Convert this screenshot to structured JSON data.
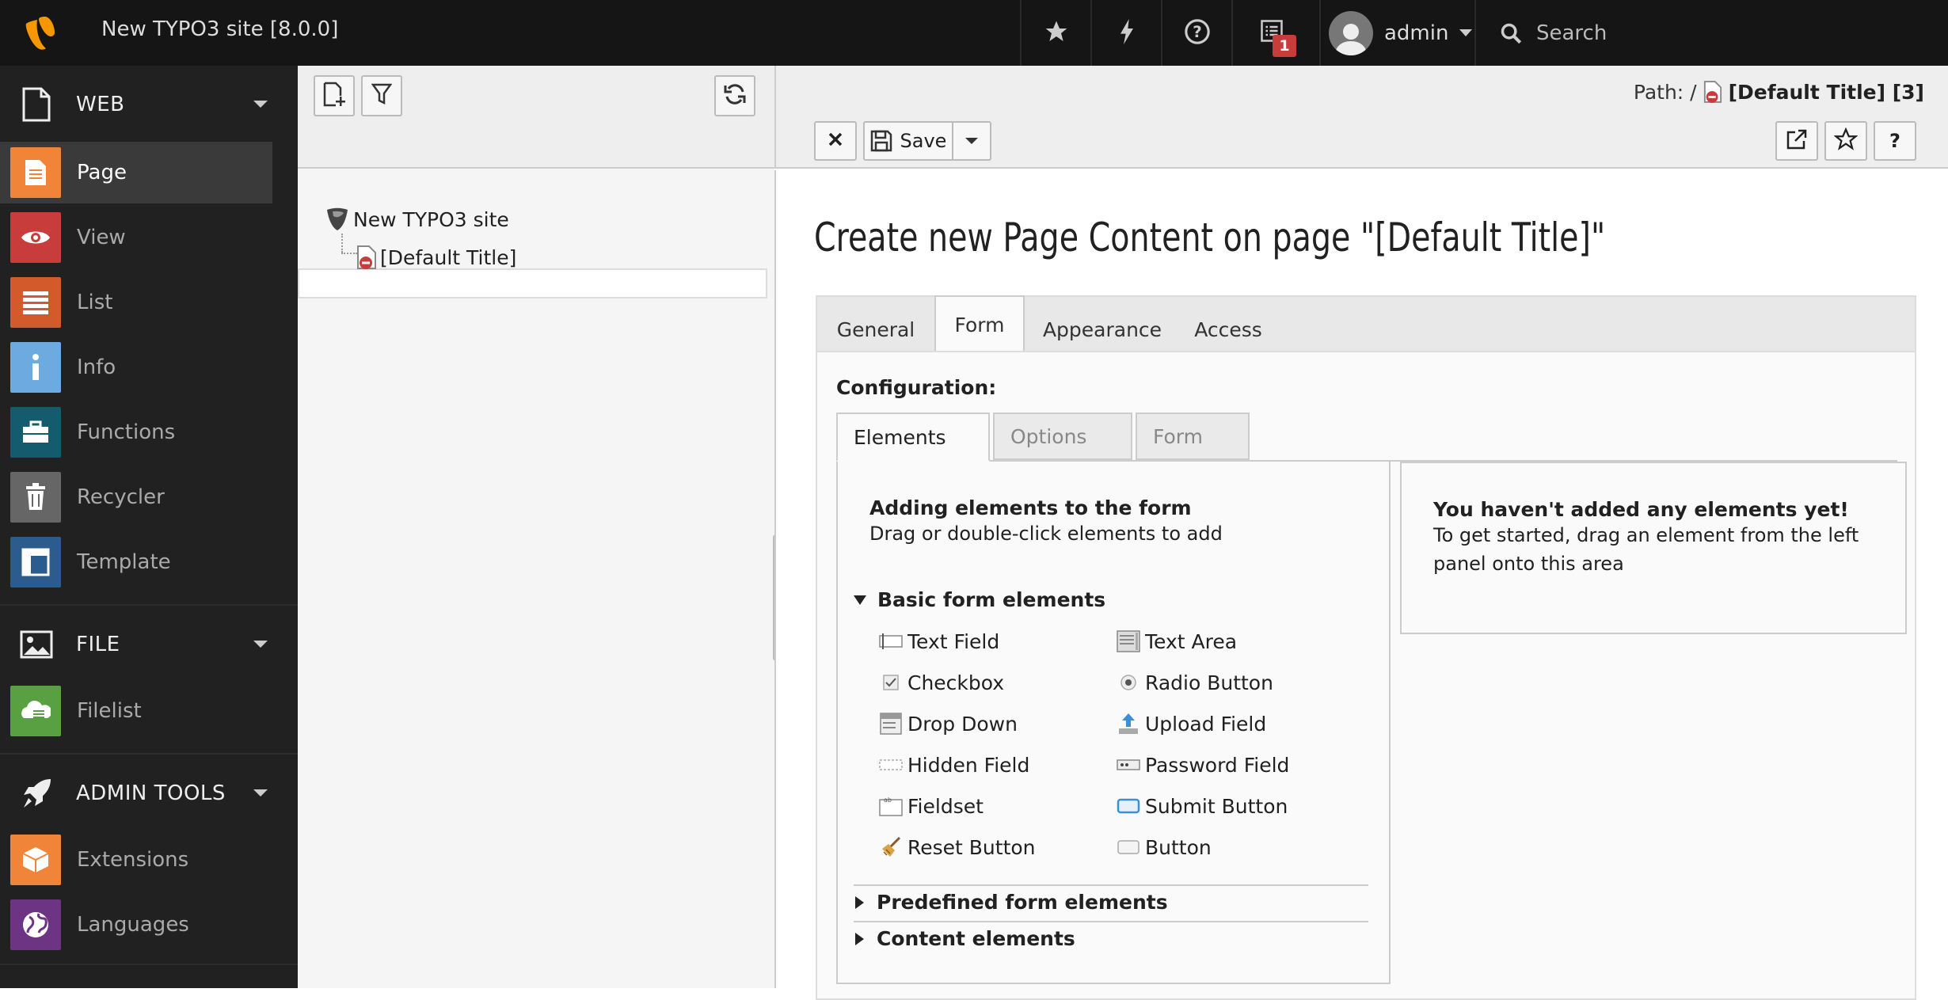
{
  "topbar": {
    "site_title": "New TYPO3 site [8.0.0]",
    "notification_count": "1",
    "username": "admin",
    "search_placeholder": "Search"
  },
  "modules": {
    "web": {
      "label": "WEB",
      "items": [
        {
          "label": "Page",
          "color": "#f0853a"
        },
        {
          "label": "View",
          "color": "#c83c3c"
        },
        {
          "label": "List",
          "color": "#d35a2a"
        },
        {
          "label": "Info",
          "color": "#6daae0"
        },
        {
          "label": "Functions",
          "color": "#145c6d"
        },
        {
          "label": "Recycler",
          "color": "#666666"
        },
        {
          "label": "Template",
          "color": "#2c5b8e"
        }
      ]
    },
    "file": {
      "label": "FILE",
      "items": [
        {
          "label": "Filelist",
          "color": "#58a042"
        }
      ]
    },
    "admin": {
      "label": "ADMIN TOOLS",
      "items": [
        {
          "label": "Extensions",
          "color": "#f0853a"
        },
        {
          "label": "Languages",
          "color": "#6c3483"
        }
      ]
    }
  },
  "tree": {
    "root": "New TYPO3 site",
    "child": "[Default Title]"
  },
  "docheader": {
    "path_label": "Path: /",
    "path_value": "[Default Title] [3]",
    "save_label": "Save"
  },
  "content": {
    "heading": "Create new Page Content on page \"[Default Title]\"",
    "tabs": [
      "General",
      "Form",
      "Appearance",
      "Access"
    ],
    "configuration_label": "Configuration:",
    "inner_tabs": [
      "Elements",
      "Options",
      "Form"
    ],
    "adding_title": "Adding elements to the form",
    "adding_text": "Drag or double-click elements to add",
    "empty_title": "You haven't added any elements yet!",
    "empty_text_1": "To get started, drag an element from the left",
    "empty_text_2": "panel onto this area",
    "basic_section": "Basic form elements",
    "elements": [
      "Text Field",
      "Text Area",
      "Checkbox",
      "Radio Button",
      "Drop Down",
      "Upload Field",
      "Hidden Field",
      "Password Field",
      "Fieldset",
      "Submit Button",
      "Reset Button",
      "Button"
    ],
    "predefined_section": "Predefined form elements",
    "content_section": "Content elements"
  }
}
